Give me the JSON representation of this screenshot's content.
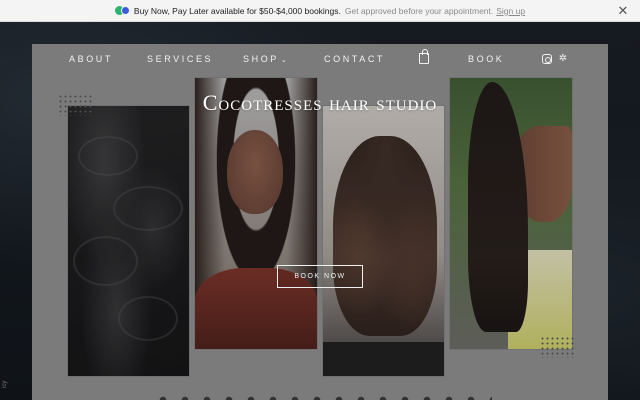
{
  "announcement": {
    "text": "Buy Now, Pay Later available for $50-$4,000 bookings.",
    "subtext": "Get approved before your appointment.",
    "link": "Sign up",
    "close": "✕"
  },
  "side_text": "icy",
  "nav": {
    "items": [
      {
        "label": "ABOUT"
      },
      {
        "label": "SERVICES"
      },
      {
        "label": "SHOP"
      },
      {
        "label": "CONTACT"
      },
      {
        "label": "BOOK"
      }
    ],
    "shop_caret": "⌄",
    "yelp_glyph": "✲",
    "icons": [
      "shopping-bag-icon",
      "instagram-icon",
      "yelp-icon"
    ]
  },
  "hero": {
    "title": "Cocotresses hair studio",
    "button": "BOOK NOW"
  },
  "colors": {
    "panel": "#8e8e8e",
    "backdrop": "#111418",
    "text": "#ffffff"
  }
}
